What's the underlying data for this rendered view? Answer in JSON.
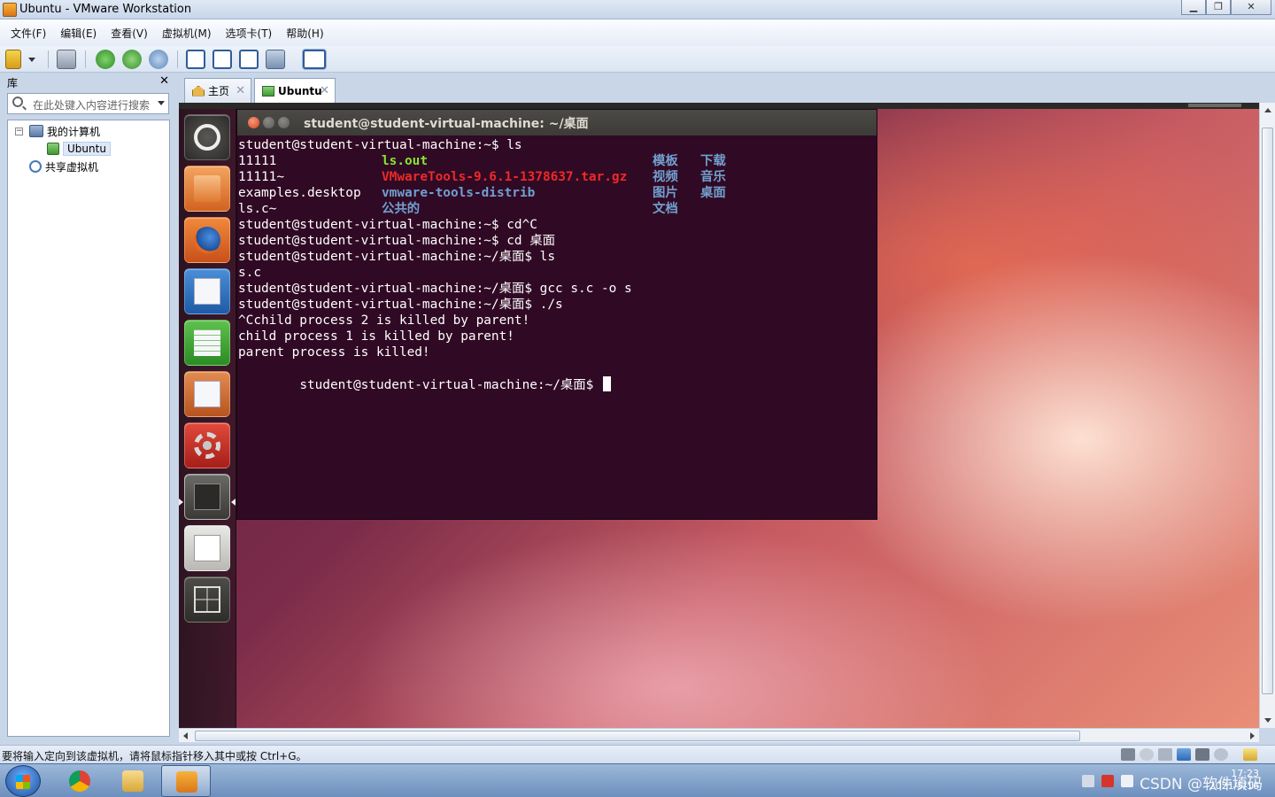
{
  "window": {
    "title": "Ubuntu - VMware Workstation"
  },
  "menu": [
    "文件(F)",
    "编辑(E)",
    "查看(V)",
    "虚拟机(M)",
    "选项卡(T)",
    "帮助(H)"
  ],
  "library": {
    "label": "库",
    "close": "✕",
    "search_placeholder": "在此处键入内容进行搜索",
    "tree": {
      "my_computer": "我的计算机",
      "vm": "Ubuntu",
      "shared": "共享虚拟机"
    }
  },
  "tabs": [
    {
      "label": "主页",
      "close": "✕"
    },
    {
      "label": "Ubuntu",
      "close": "✕"
    }
  ],
  "terminal": {
    "title": "student@student-virtual-machine: ~/桌面",
    "lines": {
      "l1": "student@student-virtual-machine:~$ ls",
      "l2a": "11111",
      "l2b": "ls.out",
      "l2c": "模板",
      "l2d": "下载",
      "l3a": "11111~",
      "l3b": "VMwareTools-9.6.1-1378637.tar.gz",
      "l3c": "视频",
      "l3d": "音乐",
      "l4a": "examples.desktop",
      "l4b": "vmware-tools-distrib",
      "l4c": "图片",
      "l4d": "桌面",
      "l5a": "ls.c~",
      "l5b": "公共的",
      "l5c": "文档",
      "l6": "student@student-virtual-machine:~$ cd^C",
      "l7": "student@student-virtual-machine:~$ cd 桌面",
      "l8": "student@student-virtual-machine:~/桌面$ ls",
      "l9": "s.c",
      "l10": "student@student-virtual-machine:~/桌面$ gcc s.c -o s",
      "l11": "student@student-virtual-machine:~/桌面$ ./s",
      "l12": "^Cchild process 2 is killed by parent!",
      "l13": "child process 1 is killed by parent!",
      "l14": "parent process is killed!",
      "l15": "student@student-virtual-machine:~/桌面$ "
    }
  },
  "statusbar": {
    "message": "要将输入定向到该虚拟机，请将鼠标指针移入其中或按 Ctrl+G。"
  },
  "taskbar": {
    "clock_time": "17:23",
    "clock_date": "2021/5/16",
    "watermark": "CSDN @软件填码"
  },
  "colors": {
    "terminal_bg": "#300a24",
    "ls_green": "#8ae234",
    "ls_red": "#ef2929",
    "ls_blue": "#729fcf"
  }
}
